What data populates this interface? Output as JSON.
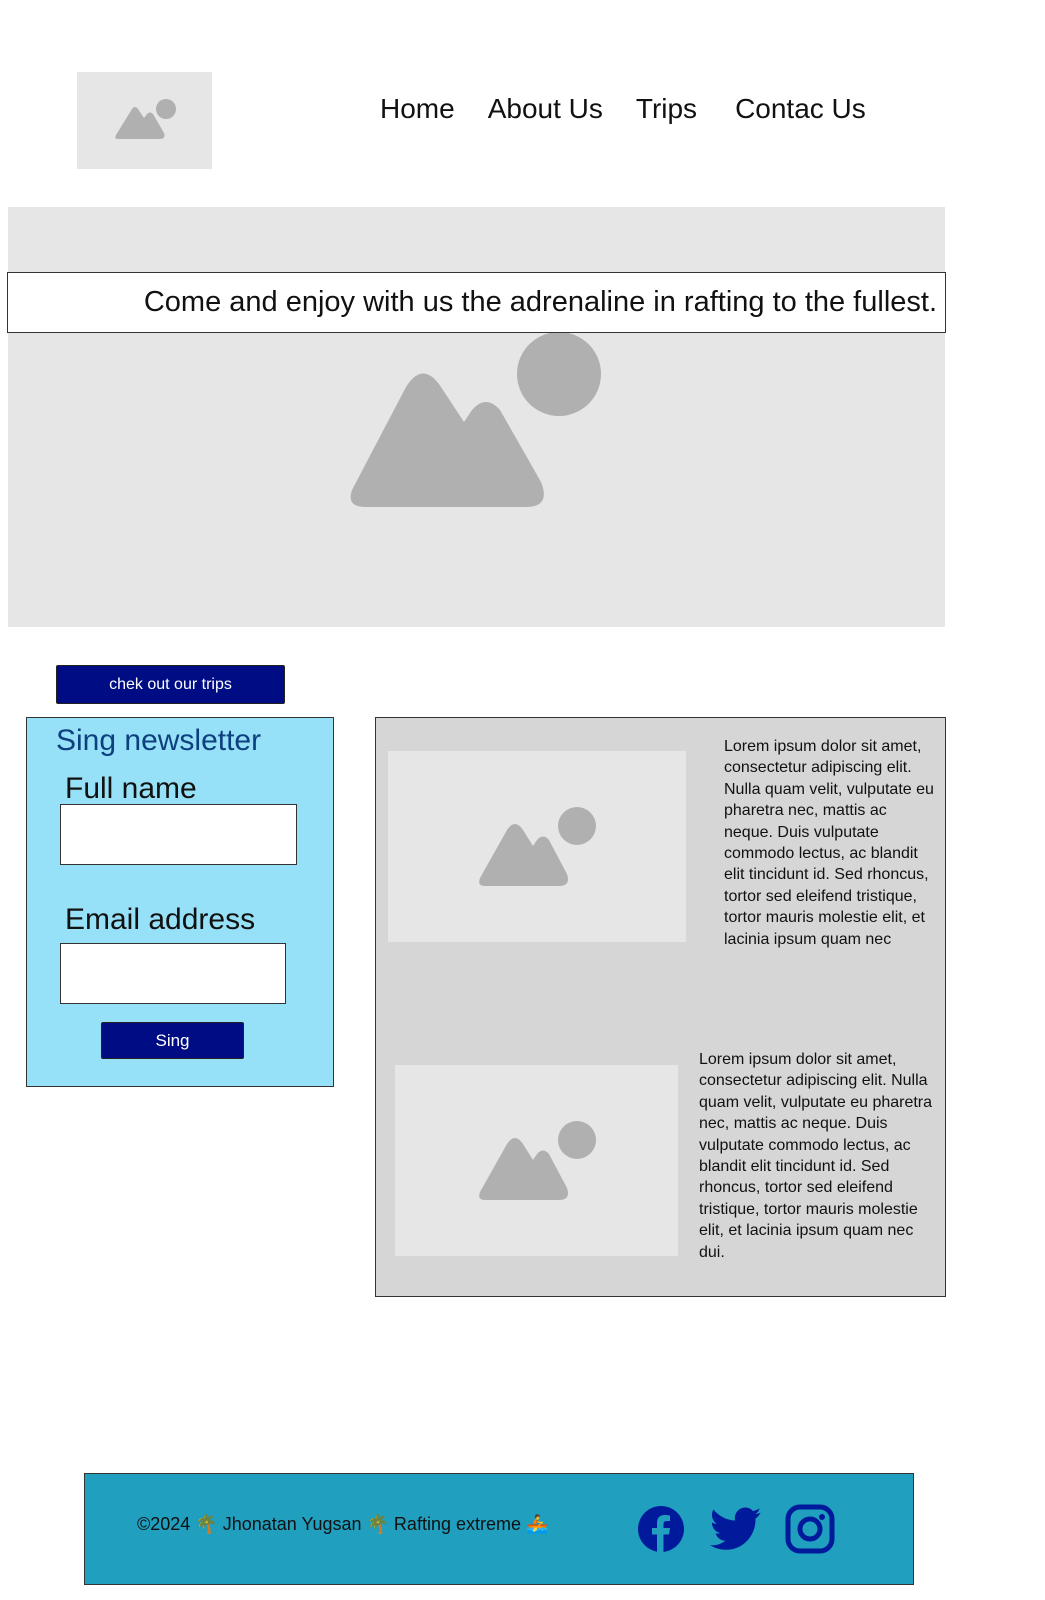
{
  "header": {
    "logo": "image-placeholder-icon",
    "nav": [
      "Home",
      "About Us",
      "Trips",
      "Contac Us"
    ]
  },
  "hero": {
    "banner": "Come and enjoy with us the adrenaline in rafting to the fullest.",
    "image": "image-placeholder-icon"
  },
  "cta": {
    "label": "chek out our trips"
  },
  "newsletter": {
    "title": "Sing newsletter",
    "name_label": "Full name",
    "name_value": "",
    "email_label": "Email address",
    "email_value": "",
    "submit_label": "Sing"
  },
  "trips": [
    {
      "image": "image-placeholder-icon",
      "text": "Lorem ipsum dolor sit amet, consectetur adipiscing elit. Nulla quam velit, vulputate eu pharetra nec, mattis ac neque. Duis vulputate commodo lectus, ac blandit elit tincidunt id. Sed rhoncus, tortor sed eleifend tristique, tortor mauris molestie elit, et lacinia ipsum quam nec"
    },
    {
      "image": "image-placeholder-icon",
      "text": "Lorem ipsum dolor sit amet, consectetur adipiscing elit. Nulla quam velit, vulputate eu pharetra nec, mattis ac neque. Duis vulputate commodo lectus, ac blandit elit tincidunt id. Sed rhoncus, tortor sed eleifend tristique, tortor mauris molestie elit, et lacinia ipsum quam nec dui."
    }
  ],
  "footer": {
    "copyright": "©2024 🌴 Jhonatan Yugsan 🌴 Rafting extreme 🚣",
    "social": [
      "facebook-icon",
      "twitter-icon",
      "instagram-icon"
    ]
  },
  "colors": {
    "button": "#000c84",
    "newsletter_bg": "#96e1f8",
    "newsletter_title": "#0e3f7e",
    "trips_bg": "#d6d6d6",
    "footer_bg": "#209fbe",
    "social_icons": "#001a9b"
  }
}
